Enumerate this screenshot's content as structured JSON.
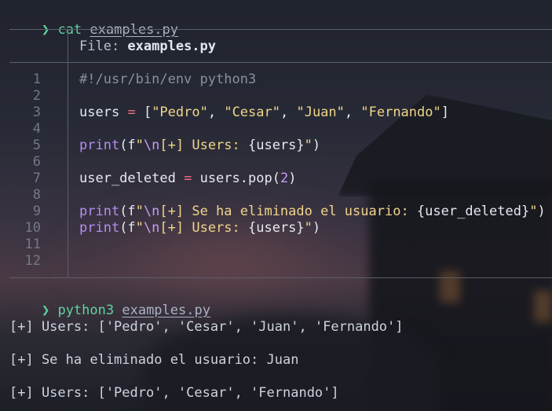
{
  "prompt": {
    "arrow": "❯",
    "command": "cat",
    "argument": "examples.py"
  },
  "header": {
    "file_label": "File: ",
    "file_name": "examples.py"
  },
  "line_numbers": [
    "1",
    "2",
    "3",
    "4",
    "5",
    "6",
    "7",
    "8",
    "9",
    "10",
    "11",
    "12"
  ],
  "code": {
    "l1": "#!/usr/bin/env python3",
    "l3": {
      "var": "users",
      "op": "=",
      "open": "[",
      "s1": "\"Pedro\"",
      "s2": "\"Cesar\"",
      "s3": "\"Juan\"",
      "s4": "\"Fernando\"",
      "close": "]",
      "sep": ", "
    },
    "l5": {
      "fn": "print",
      "open": "(f",
      "q": "\"",
      "esc": "\\n",
      "text": "[+] Users: ",
      "interp": "{users}",
      "close_q": "\"",
      "close": ")"
    },
    "l7": {
      "var": "user_deleted",
      "op": "=",
      "call": "users.pop(",
      "num": "2",
      "close": ")"
    },
    "l9": {
      "fn": "print",
      "open": "(f",
      "q": "\"",
      "esc": "\\n",
      "text": "[+] Se ha eliminado el usuario: ",
      "interp": "{user_deleted}",
      "close_q": "\"",
      "close": ")"
    },
    "l10": {
      "fn": "print",
      "open": "(f",
      "q": "\"",
      "esc": "\\n",
      "text": "[+] Users: ",
      "interp": "{users}",
      "close_q": "\"",
      "close": ")"
    }
  },
  "prompt2": {
    "arrow": "❯",
    "command": "python3",
    "argument": "examples.py"
  },
  "output": {
    "line1": "[+] Users: ['Pedro', 'Cesar', 'Juan', 'Fernando']",
    "line2": "[+] Se ha eliminado el usuario: Juan",
    "line3": "[+] Users: ['Pedro', 'Cesar', 'Fernando']"
  }
}
